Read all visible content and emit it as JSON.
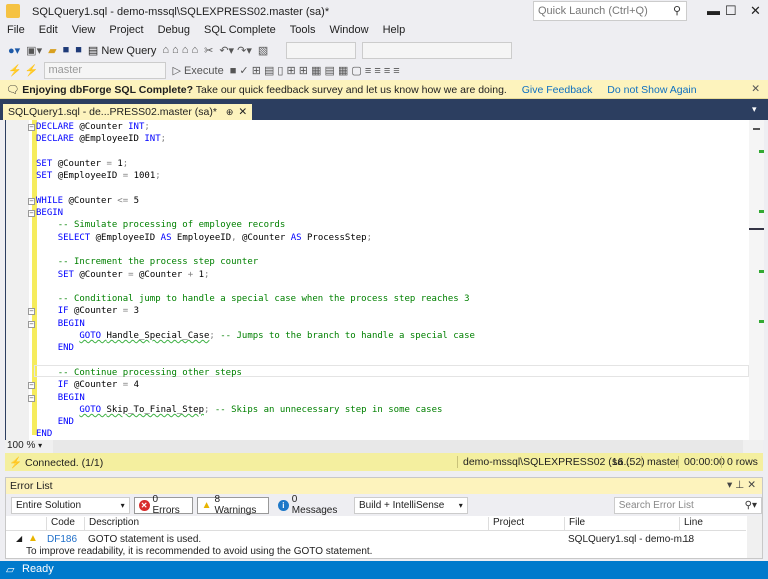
{
  "window": {
    "title": "SQLQuery1.sql - demo-mssql\\SQLEXPRESS02.master (sa)*",
    "quick_launch_placeholder": "Quick Launch (Ctrl+Q)",
    "minimize": "▬",
    "maximize": "☐",
    "close": "✕"
  },
  "menu": [
    "File",
    "Edit",
    "View",
    "Project",
    "Debug",
    "SQL Complete",
    "Tools",
    "Window",
    "Help"
  ],
  "toolbar": {
    "new_query": "New Query",
    "database": "master",
    "execute": "Execute"
  },
  "notice": {
    "bold": "Enjoying dbForge SQL Complete?",
    "text": "Take our quick feedback survey and let us know how we are doing.",
    "give_feedback": "Give Feedback",
    "dont_show": "Do not Show Again",
    "close": "✕"
  },
  "doc_tab": {
    "label": "SQLQuery1.sql - de...PRESS02.master (sa)*",
    "pin": "⊕",
    "close": "✕"
  },
  "code": [
    [
      [
        "kw",
        "DECLARE "
      ],
      [
        "id",
        "@Counter "
      ],
      [
        "kw",
        "INT"
      ],
      [
        "op",
        ";"
      ]
    ],
    [
      [
        "kw",
        "DECLARE "
      ],
      [
        "id",
        "@EmployeeID "
      ],
      [
        "kw",
        "INT"
      ],
      [
        "op",
        ";"
      ]
    ],
    [],
    [
      [
        "kw",
        "SET "
      ],
      [
        "id",
        "@Counter "
      ],
      [
        "op",
        "= "
      ],
      [
        "id",
        "1"
      ],
      [
        "op",
        ";"
      ]
    ],
    [
      [
        "kw",
        "SET "
      ],
      [
        "id",
        "@EmployeeID "
      ],
      [
        "op",
        "= "
      ],
      [
        "id",
        "1001"
      ],
      [
        "op",
        ";"
      ]
    ],
    [],
    [
      [
        "kw",
        "WHILE "
      ],
      [
        "id",
        "@Counter "
      ],
      [
        "op",
        "<= "
      ],
      [
        "id",
        "5"
      ]
    ],
    [
      [
        "kw",
        "BEGIN"
      ]
    ],
    [
      [
        "id",
        "    "
      ],
      [
        "cm",
        "-- Simulate processing of employee records"
      ]
    ],
    [
      [
        "id",
        "    "
      ],
      [
        "kw",
        "SELECT "
      ],
      [
        "id",
        "@EmployeeID "
      ],
      [
        "kw",
        "AS "
      ],
      [
        "id",
        "EmployeeID"
      ],
      [
        "op",
        ", "
      ],
      [
        "id",
        "@Counter "
      ],
      [
        "kw",
        "AS "
      ],
      [
        "id",
        "ProcessStep"
      ],
      [
        "op",
        ";"
      ]
    ],
    [],
    [
      [
        "id",
        "    "
      ],
      [
        "cm",
        "-- Increment the process step counter"
      ]
    ],
    [
      [
        "id",
        "    "
      ],
      [
        "kw",
        "SET "
      ],
      [
        "id",
        "@Counter "
      ],
      [
        "op",
        "= "
      ],
      [
        "id",
        "@Counter "
      ],
      [
        "op",
        "+ "
      ],
      [
        "id",
        "1"
      ],
      [
        "op",
        ";"
      ]
    ],
    [],
    [
      [
        "id",
        "    "
      ],
      [
        "cm",
        "-- Conditional jump to handle a special case when the process step reaches 3"
      ]
    ],
    [
      [
        "id",
        "    "
      ],
      [
        "kw",
        "IF "
      ],
      [
        "id",
        "@Counter "
      ],
      [
        "op",
        "= "
      ],
      [
        "id",
        "3"
      ]
    ],
    [
      [
        "id",
        "    "
      ],
      [
        "kw",
        "BEGIN"
      ]
    ],
    [
      [
        "id",
        "        "
      ],
      [
        "kw sq",
        "GOTO "
      ],
      [
        "id sq",
        "Handle_Special_Case"
      ],
      [
        "op",
        ";"
      ],
      [
        "cm",
        " -- Jumps to the branch to handle a special case"
      ]
    ],
    [
      [
        "id",
        "    "
      ],
      [
        "kw",
        "END"
      ]
    ],
    [],
    [
      [
        "id",
        "    "
      ],
      [
        "cm",
        "-- Continue processing other steps"
      ]
    ],
    [
      [
        "id",
        "    "
      ],
      [
        "kw",
        "IF "
      ],
      [
        "id",
        "@Counter "
      ],
      [
        "op",
        "= "
      ],
      [
        "id",
        "4"
      ]
    ],
    [
      [
        "id",
        "    "
      ],
      [
        "kw",
        "BEGIN"
      ]
    ],
    [
      [
        "id",
        "        "
      ],
      [
        "kw sq",
        "GOTO "
      ],
      [
        "id sq",
        "Skip_To_Final_Step"
      ],
      [
        "op",
        ";"
      ],
      [
        "cm",
        " -- Skips an unnecessary step in some cases"
      ]
    ],
    [
      [
        "id",
        "    "
      ],
      [
        "kw",
        "END"
      ]
    ],
    [
      [
        "kw",
        "END"
      ]
    ]
  ],
  "editor": {
    "zoom": "100 %"
  },
  "connection": {
    "status": "Connected. (1/1)",
    "server": "demo-mssql\\SQLEXPRESS02 (16...",
    "user": "sa (52)",
    "database": "master",
    "time": "00:00:00",
    "rows": "0 rows"
  },
  "error_list": {
    "title": "Error List",
    "scope": "Entire Solution",
    "errors": "0 Errors",
    "warnings": "8 Warnings",
    "messages": "0 Messages",
    "source": "Build + IntelliSense",
    "search_placeholder": "Search Error List",
    "columns": [
      "Code",
      "Description",
      "Project",
      "File",
      "Line"
    ],
    "rows": [
      {
        "code": "DF186",
        "description": "GOTO statement is used.",
        "detail": "To improve readability, it is recommended to avoid using the GOTO statement.",
        "project": "",
        "file": "SQLQuery1.sql - demo-m...",
        "line": "18"
      }
    ]
  },
  "status": {
    "text": "Ready"
  },
  "colors": {
    "accent": "#007acc",
    "keyword": "#0000ff",
    "comment": "#008000",
    "notice": "#fdf3bd"
  }
}
